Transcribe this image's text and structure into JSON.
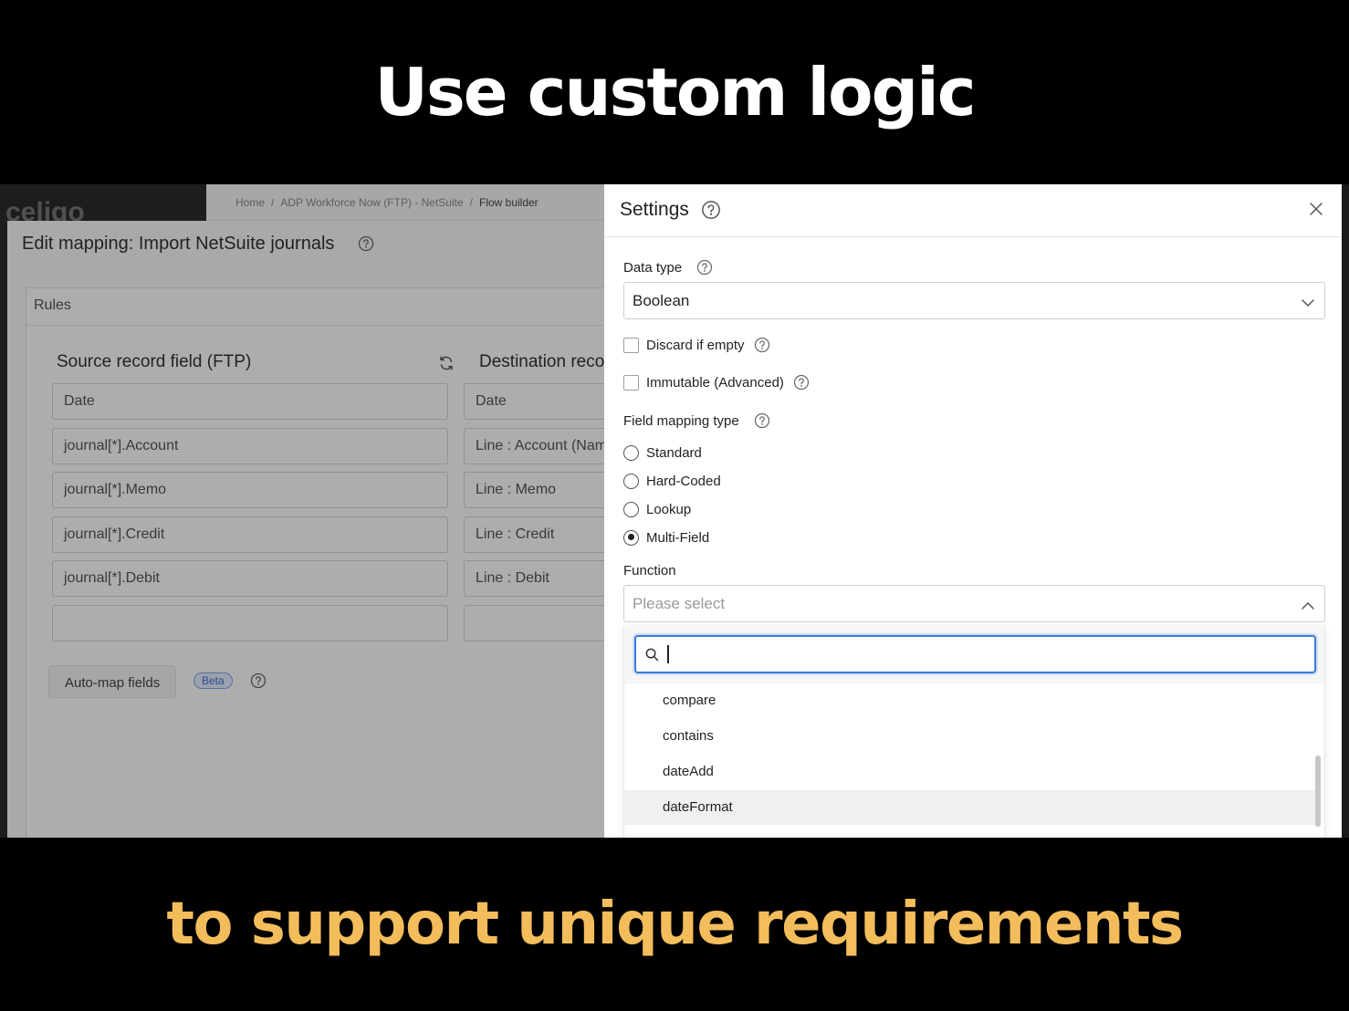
{
  "headline": {
    "top": "Use custom logic",
    "bottom": "to support unique requirements"
  },
  "background_app": {
    "logo": "celigo",
    "breadcrumbs": [
      "Home",
      "ADP Workforce Now (FTP) - NetSuite",
      "Flow builder"
    ],
    "breadcrumb_separator": "/",
    "title": "Edit mapping: Import NetSuite journals",
    "rules_label": "Rules",
    "source_header": "Source record field (FTP)",
    "destination_header": "Destination record field (NetSuite)",
    "rows": [
      {
        "source": "Date",
        "destination": "Date"
      },
      {
        "source": "journal[*].Account",
        "destination": "Line : Account (Name)"
      },
      {
        "source": "journal[*].Memo",
        "destination": "Line : Memo"
      },
      {
        "source": "journal[*].Credit",
        "destination": "Line : Credit"
      },
      {
        "source": "journal[*].Debit",
        "destination": "Line : Debit"
      },
      {
        "source": "",
        "destination": ""
      }
    ],
    "automap_label": "Auto-map fields",
    "beta_badge": "Beta"
  },
  "settings": {
    "title": "Settings",
    "data_type": {
      "label": "Data type",
      "value": "Boolean"
    },
    "discard_if_empty": {
      "label": "Discard if empty",
      "checked": false
    },
    "immutable": {
      "label": "Immutable (Advanced)",
      "checked": false
    },
    "field_mapping_type": {
      "label": "Field mapping type",
      "options": [
        "Standard",
        "Hard-Coded",
        "Lookup",
        "Multi-Field"
      ],
      "selected": "Multi-Field"
    },
    "function": {
      "label": "Function",
      "placeholder": "Please select",
      "search_value": "",
      "options": [
        "compare",
        "contains",
        "dateAdd",
        "dateFormat"
      ],
      "highlighted": "dateFormat"
    }
  },
  "colors": {
    "headline_top": "#ffffff",
    "headline_bottom": "#f3bd5c",
    "focus_ring": "#3a7bd5",
    "beta_badge": "#3d6fd6"
  },
  "icons": [
    "help-icon",
    "close-icon",
    "chevron-down-icon",
    "chevron-up-icon",
    "search-icon",
    "refresh-icon"
  ]
}
